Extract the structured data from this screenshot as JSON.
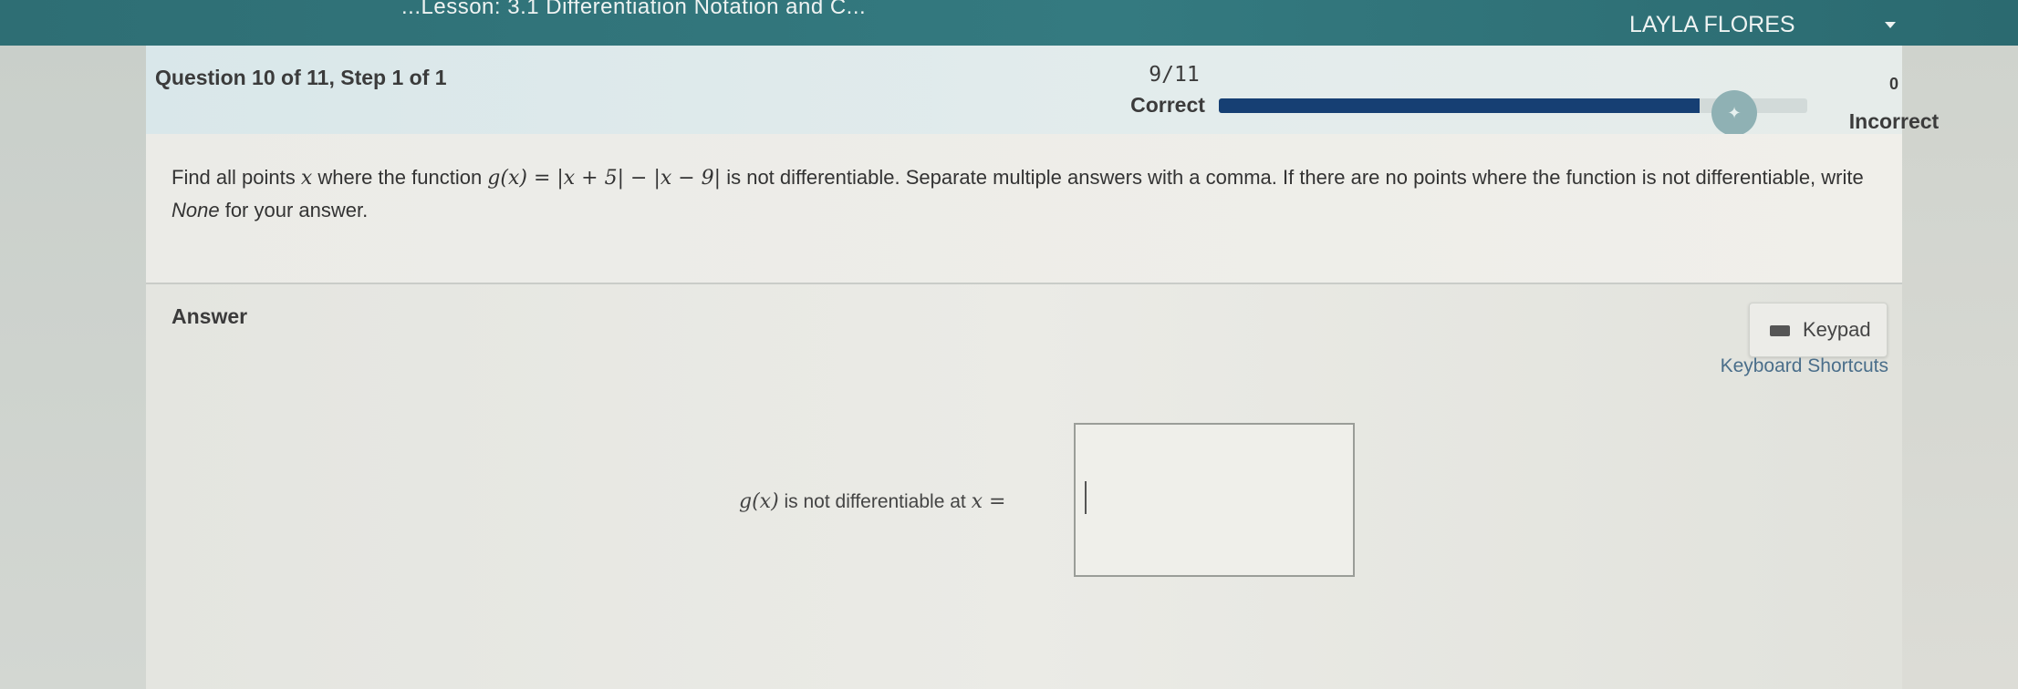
{
  "topbar": {
    "breadcrumb": "...Lesson: 3.1 Differentiation Notation and C...",
    "user_name": "LAYLA FLORES"
  },
  "header": {
    "question_title": "Question 10 of 11,  Step 1 of 1",
    "score": "9/11",
    "correct_label": "Correct",
    "progress_fraction": 0.817,
    "incorrect_count": "0",
    "incorrect_label": "Incorrect",
    "accent_color": "#163f73"
  },
  "question": {
    "text_before": "Find all points ",
    "var": "x",
    "text_mid": " where the function ",
    "function_expr": "g(x) = |x + 5| − |x − 9|",
    "text_after": " is not differentiable. Separate multiple answers with a comma. If there are no points where the function is not differentiable, write ",
    "none_word": "None",
    "text_end": " for your answer."
  },
  "answer": {
    "label": "Answer",
    "keypad_label": "Keypad",
    "shortcuts_label": "Keyboard Shortcuts",
    "prompt_func": "g(x)",
    "prompt_text": " is not differentiable at ",
    "prompt_var": "x =",
    "input_value": ""
  }
}
